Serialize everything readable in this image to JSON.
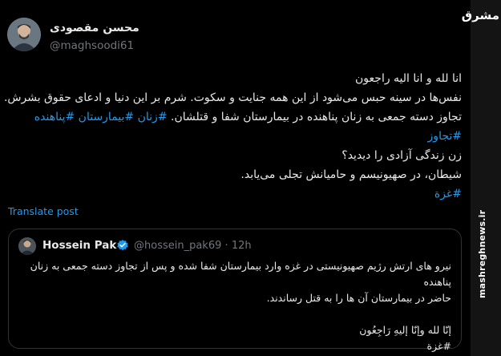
{
  "author": {
    "display_name": "محسن مقصودی",
    "handle": "@maghsoodi61"
  },
  "tweet": {
    "lines": [
      "انا لله و انا الیه راجعون",
      "نفس‌ها در سینه حبس می‌شود از این همه جنایت و سکوت. شرم بر این دنیا و ادعای حقوق بشرش.",
      "تجاوز دسته جمعی به زنان پناهنده در بیمارستان شفا و قتلشان.",
      "زن زندگی آزادی را دیدید؟",
      "شیطان، در صهیونیسم و حامیانش تجلی می‌یابد."
    ],
    "hashtags": {
      "women": "#زنان",
      "hospital": "#بیمارستان",
      "refugee": "#پناهنده",
      "assault": "#تجاوز",
      "gaza": "#غزة"
    }
  },
  "translate_label": "Translate post",
  "quoted": {
    "display_name": "Hossein Pak",
    "handle": "@hossein_pak69",
    "separator": "·",
    "time": "12h",
    "lines": [
      "نیرو های ارتش رژیم صهیونیستی در غزه وارد بیمارستان شفا شده و پس از تجاوز دسته جمعی به زنان پناهنده",
      "حاضر در بیمارستان  آن ها را به قتل رساندند.",
      "إنّا لله وإنّا إليهِ رَاجِعُون",
      "#غزة"
    ]
  },
  "watermark": {
    "logo": "مشرق",
    "site": "mashreghnews.ir"
  },
  "colors": {
    "background": "#000000",
    "text": "#e7e9ea",
    "secondary": "#71767b",
    "link": "#1d9bf0",
    "border": "#2f3336",
    "verified": "#1d9bf0"
  }
}
